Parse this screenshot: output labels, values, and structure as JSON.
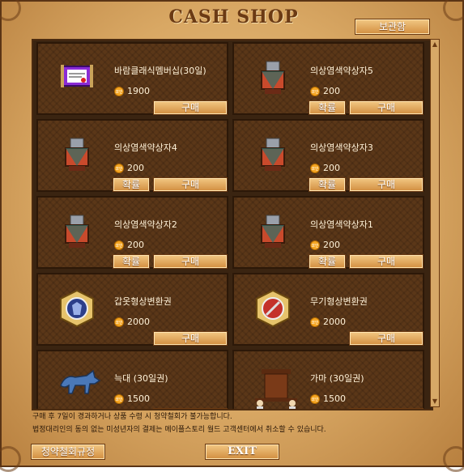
{
  "title": "CASH SHOP",
  "storage_label": "보관함",
  "coin_label": "코인",
  "buy_label": "구매",
  "refund_label": "확률",
  "items": [
    {
      "name": "바람클래식멤버십(30일)",
      "price": "1900",
      "icon": "membership-scroll-icon",
      "has_refund": false
    },
    {
      "name": "의상염색약상자5",
      "price": "200",
      "icon": "dye-box-icon",
      "has_refund": true
    },
    {
      "name": "의상염색약상자4",
      "price": "200",
      "icon": "dye-box-icon",
      "has_refund": true
    },
    {
      "name": "의상염색약상자3",
      "price": "200",
      "icon": "dye-box-icon",
      "has_refund": true
    },
    {
      "name": "의상염색약상자2",
      "price": "200",
      "icon": "dye-box-icon",
      "has_refund": true
    },
    {
      "name": "의상염색약상자1",
      "price": "200",
      "icon": "dye-box-icon",
      "has_refund": true
    },
    {
      "name": "갑옷형상변환권",
      "price": "2000",
      "icon": "armor-ticket-icon",
      "has_refund": false
    },
    {
      "name": "무기형상변환권",
      "price": "2000",
      "icon": "weapon-ticket-icon",
      "has_refund": false
    },
    {
      "name": "늑대 (30일권)",
      "price": "1500",
      "icon": "wolf-icon",
      "has_refund": false
    },
    {
      "name": "가마 (30일권)",
      "price": "1500",
      "icon": "palanquin-icon",
      "has_refund": false
    }
  ],
  "notice": {
    "line1": "구매 후 7일이 경과하거나 상품 수령 시 청약철회가 불가능합니다.",
    "line2": "법정대리인의 동의 없는 미성년자의 결제는 메이플스토리 월드 고객센터에서 취소할 수 있습니다."
  },
  "policy_label": "청약철회규정",
  "exit_label": "EXIT",
  "colors": {
    "card_bg": "#5b3718",
    "button": "#d28e40",
    "text": "#fff2d8",
    "coin": "#f5a623"
  }
}
